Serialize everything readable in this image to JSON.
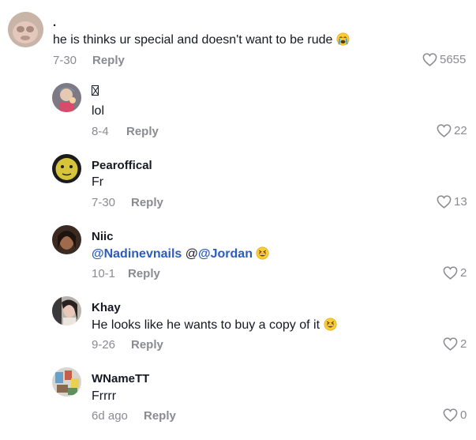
{
  "comments": [
    {
      "username": ".",
      "text": "he is thinks ur special and doesn't want to be rude",
      "emoji": "crying-face",
      "date": "7-30",
      "reply_label": "Reply",
      "likes": "5655"
    },
    {
      "username": "",
      "username_glyph": "unrendered-character-box",
      "text": "lol",
      "date": "8-4",
      "reply_label": "Reply",
      "likes": "22"
    },
    {
      "username": "Pearoffical",
      "text": "Fr",
      "date": "7-30",
      "reply_label": "Reply",
      "likes": "13"
    },
    {
      "username": "Niic",
      "mention1": "@Nadinevnails",
      "mention_at": "@",
      "mention2": "@Jordan",
      "emoji": "grinning-squinting-face",
      "date": "10-1",
      "reply_label": "Reply",
      "likes": "2"
    },
    {
      "username": "Khay",
      "text": "He looks like he wants to buy a copy of it",
      "emoji": "grinning-squinting-face",
      "date": "9-26",
      "reply_label": "Reply",
      "likes": "2"
    },
    {
      "username": "WNameTT",
      "text": "Frrrr",
      "date": "6d ago",
      "reply_label": "Reply",
      "likes": "0"
    }
  ],
  "colors": {
    "text": "#161823",
    "muted": "#8a8b91",
    "mention": "#2b5db9"
  },
  "icons": [
    "heart-outline-icon",
    "avatar"
  ]
}
